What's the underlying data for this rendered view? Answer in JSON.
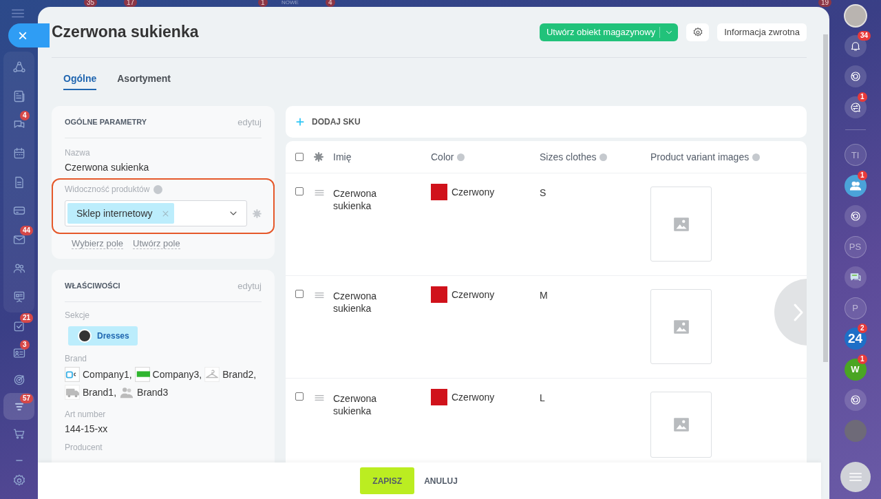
{
  "top_strip": [
    "35",
    "17",
    "1",
    "NOWE",
    "4",
    "19"
  ],
  "left_sidebar": {
    "close_label": "×",
    "items": [
      {
        "kind": "flow",
        "selected": false
      },
      {
        "kind": "news",
        "selected": false
      },
      {
        "kind": "chat",
        "badge": "4",
        "selected": false
      },
      {
        "kind": "calendar",
        "selected": false
      },
      {
        "kind": "doc",
        "selected": false
      },
      {
        "kind": "card",
        "selected": false
      },
      {
        "kind": "mail",
        "badge": "44",
        "selected": false
      },
      {
        "kind": "people",
        "selected": false
      },
      {
        "kind": "board",
        "selected": false
      },
      {
        "kind": "tasks",
        "badge": "21",
        "selected": false
      },
      {
        "kind": "contact",
        "badge": "3",
        "selected": false
      },
      {
        "kind": "target",
        "selected": false
      },
      {
        "kind": "funnel",
        "badge": "57",
        "selected": true
      },
      {
        "kind": "cart",
        "selected": false
      },
      {
        "kind": "more",
        "selected": false
      }
    ]
  },
  "right_bar": {
    "items": [
      {
        "kind": "avatar"
      },
      {
        "kind": "bell",
        "badge": "34"
      },
      {
        "kind": "orbit"
      },
      {
        "kind": "chat",
        "badge": "1"
      },
      {
        "kind": "initials",
        "text": "TI"
      },
      {
        "kind": "group",
        "badge": "1"
      },
      {
        "kind": "orbit"
      },
      {
        "kind": "initials",
        "text": "PS"
      },
      {
        "kind": "message"
      },
      {
        "kind": "initials",
        "text": "P"
      },
      {
        "kind": "brand",
        "text": "24",
        "badge": "2",
        "color": "#1e6fc7"
      },
      {
        "kind": "brand",
        "text": "W",
        "badge": "1",
        "color": "#4aa523"
      },
      {
        "kind": "orbit"
      },
      {
        "kind": "photo"
      }
    ]
  },
  "panel": {
    "title": "Czerwona sukienka",
    "create_button": "Utwórz obiekt magazynowy",
    "feedback_button": "Informacja zwrotna",
    "tabs": [
      {
        "label": "Ogólne",
        "selected": true
      },
      {
        "label": "Asortyment",
        "selected": false
      }
    ],
    "general_card": {
      "title": "OGÓLNE PARAMETRY",
      "edit": "edytuj",
      "name_label": "Nazwa",
      "name_value": "Czerwona sukienka",
      "visibility": {
        "label": "Widoczność produktów",
        "tags": [
          "Sklep internetowy"
        ],
        "highlighted": true
      },
      "links": [
        "Wybierz pole",
        "Utwórz pole"
      ]
    },
    "properties_card": {
      "title": "WŁAŚCIWOŚCI",
      "edit": "edytuj",
      "sections_label": "Sekcje",
      "section_tag": "Dresses",
      "brand_label": "Brand",
      "brands": [
        {
          "kind": "square",
          "name": "Company1,"
        },
        {
          "kind": "banner",
          "name": "Company3,"
        },
        {
          "kind": "hanger",
          "name": "Brand2,"
        },
        {
          "kind": "truck",
          "name": "Brand1,"
        },
        {
          "kind": "people",
          "name": "Brand3"
        }
      ],
      "art_label": "Art number",
      "art_value": "144-15-xx",
      "producer_label": "Producent"
    },
    "add_sku": "DODAJ SKU",
    "table": {
      "select_all_checked": false,
      "columns": [
        "Imię",
        "Color",
        "Sizes clothes",
        "Product variant images"
      ],
      "rows": [
        {
          "checked": false,
          "name": "Czerwona sukienka",
          "color_name": "Czerwony",
          "color": "#d0121b",
          "size": "S"
        },
        {
          "checked": false,
          "name": "Czerwona sukienka",
          "color_name": "Czerwony",
          "color": "#d0121b",
          "size": "M"
        },
        {
          "checked": false,
          "name": "Czerwona sukienka",
          "color_name": "Czerwony",
          "color": "#d0121b",
          "size": "L"
        }
      ]
    },
    "footer": {
      "save": "ZAPISZ",
      "cancel": "ANULUJ"
    }
  }
}
